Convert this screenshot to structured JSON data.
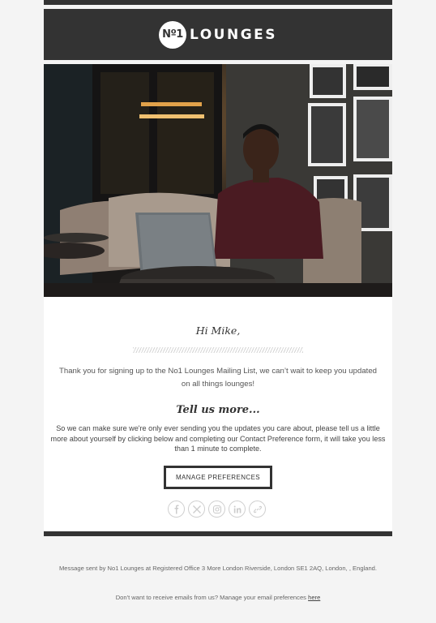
{
  "brand": {
    "logo_mark": "Nº1",
    "logo_word": "LOUNGES"
  },
  "hero": {
    "icon": "hero-photo"
  },
  "greeting": "Hi Mike,",
  "thanks_text": "Thank you for signing up to the No1 Lounges Mailing List, we can’t wait to keep you updated on all things lounges!",
  "tell_heading": "Tell us more...",
  "body_text": "So we can make sure we're only ever sending you the updates you care about, please tell us a little more about yourself by clicking below and completing our Contact Preference form, it will take you less than 1 minute to complete.",
  "cta_label": "MANAGE PREFERENCES",
  "socials": [
    "facebook-icon",
    "x-icon",
    "instagram-icon",
    "linkedin-icon",
    "link-icon"
  ],
  "footer": {
    "address": "Message sent by No1 Lounges at Registered Office 3 More London Riverside, London SE1 2AQ, London, , England.",
    "unsubscribe_text": "Don't want to receive emails from us? Manage your email preferences",
    "unsubscribe_link": "here"
  },
  "colors": {
    "dark": "#333333",
    "background": "#f4f4f4"
  }
}
